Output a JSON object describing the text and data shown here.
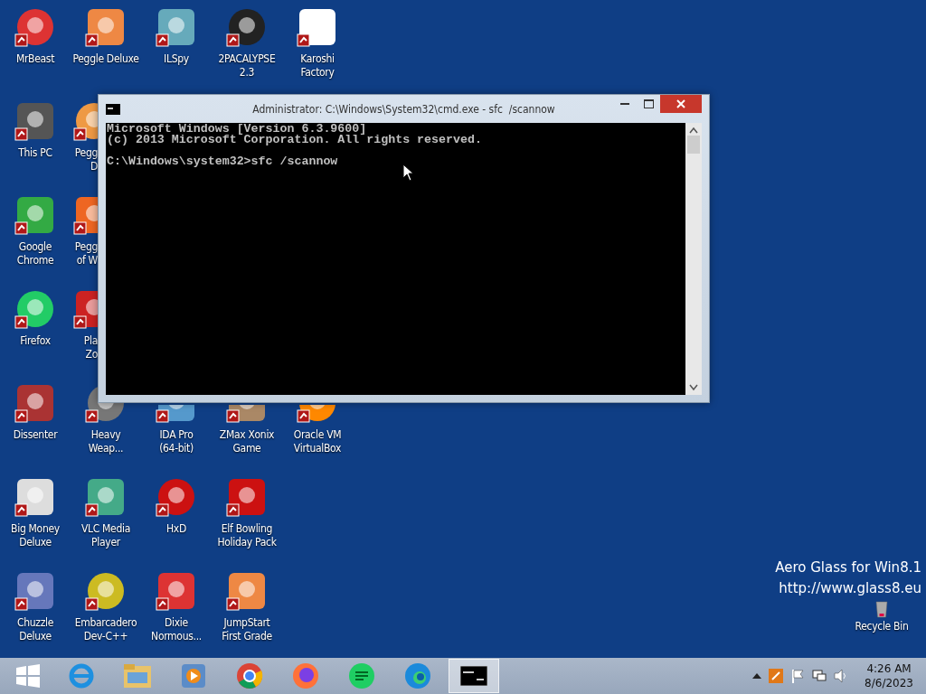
{
  "desktop": {
    "rows": [
      [
        {
          "kind": "full",
          "label": "MrBeast"
        },
        {
          "kind": "full",
          "label": "Peggle Deluxe"
        },
        {
          "kind": "full",
          "label": "ILSpy"
        },
        {
          "kind": "full",
          "label": "2PACALYPSE\n2.3"
        },
        {
          "kind": "full",
          "label": "Karoshi\nFactory"
        }
      ],
      [
        {
          "kind": "full",
          "label": "This PC"
        },
        {
          "kind": "cut",
          "label": "Pegg\nD"
        }
      ],
      [
        {
          "kind": "full",
          "label": "Google\nChrome"
        },
        {
          "kind": "cut",
          "label": "Pegg\nof W"
        }
      ],
      [
        {
          "kind": "full",
          "label": "Firefox"
        },
        {
          "kind": "cut",
          "label": "Pla\nZo"
        }
      ],
      [
        {
          "kind": "full",
          "label": "Dissenter"
        },
        {
          "kind": "full",
          "label": "Heavy\nWeap..."
        },
        {
          "kind": "under",
          "label": "IDA Pro\n(64-bit)"
        },
        {
          "kind": "under",
          "label": "ZMax Xonix\nGame"
        },
        {
          "kind": "under",
          "label": "Oracle VM\nVirtualBox"
        }
      ],
      [
        {
          "kind": "full",
          "label": "Big Money\nDeluxe"
        },
        {
          "kind": "full",
          "label": "VLC Media\nPlayer"
        },
        {
          "kind": "full",
          "label": "HxD"
        },
        {
          "kind": "full",
          "label": "Elf Bowling\nHoliday Pack"
        }
      ],
      [
        {
          "kind": "full",
          "label": "Chuzzle\nDeluxe"
        },
        {
          "kind": "full",
          "label": "Embarcadero\nDev-C++"
        },
        {
          "kind": "full",
          "label": "Dixie\nNormous..."
        },
        {
          "kind": "full",
          "label": "JumpStart\nFirst Grade"
        }
      ]
    ]
  },
  "overlay_text": [
    "Aero Glass for Win8.1",
    "http://www.glass8.eu"
  ],
  "recycle_bin": {
    "label": "Recycle Bin"
  },
  "window": {
    "title": "Administrator: C:\\Windows\\System32\\cmd.exe - sfc  /scannow",
    "console": {
      "output": [
        "Microsoft Windows [Version 6.3.9600]",
        "(c) 2013 Microsoft Corporation. All rights reserved."
      ],
      "prompt": "C:\\Windows\\system32>sfc /scannow"
    }
  },
  "taskbar": {
    "items": [
      {
        "selected": false
      },
      {
        "selected": false
      },
      {
        "selected": false
      },
      {
        "selected": false
      },
      {
        "selected": false
      },
      {
        "selected": false
      },
      {
        "selected": false
      },
      {
        "selected": true
      }
    ],
    "time": "4:26 AM",
    "date": "8/6/2023"
  }
}
